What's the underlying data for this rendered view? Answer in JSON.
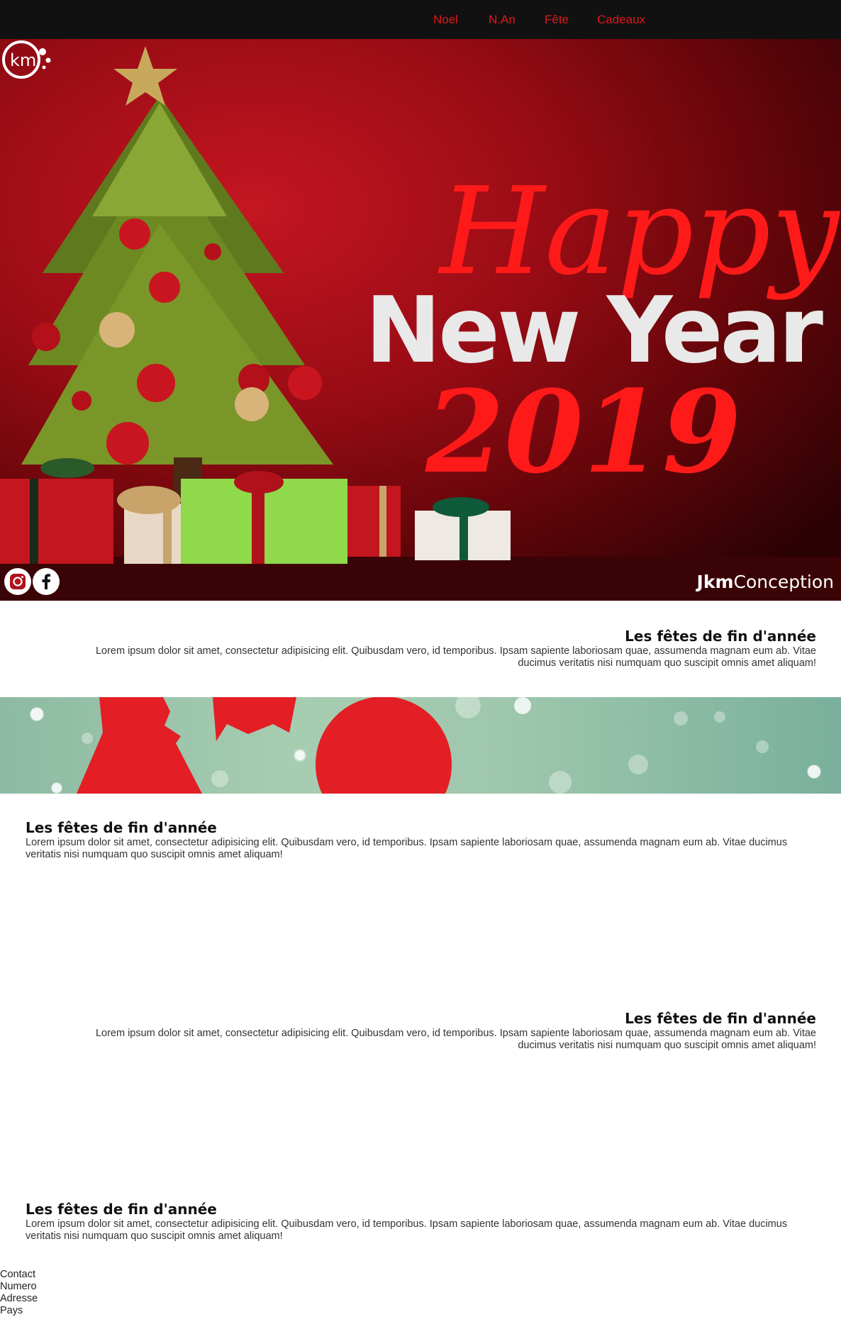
{
  "nav": {
    "items": [
      {
        "label": "Noel"
      },
      {
        "label": "N.An"
      },
      {
        "label": "Fête"
      },
      {
        "label": "Cadeaux"
      }
    ]
  },
  "hero": {
    "script_text": "Happy",
    "headline": "New Year",
    "year": "2019",
    "brand_bold": "Jkm",
    "brand_light": "Conception",
    "logo_text": "km"
  },
  "sections": [
    {
      "title": "Les fêtes de fin d'année",
      "body": "Lorem ipsum dolor sit amet, consectetur adipisicing elit. Quibusdam vero, id temporibus. Ipsam sapiente laboriosam quae, assumenda magnam eum ab. Vitae ducimus veritatis nisi numquam quo suscipit omnis amet aliquam!"
    },
    {
      "title": "Les fêtes de fin d'année",
      "body": "Lorem ipsum dolor sit amet, consectetur adipisicing elit. Quibusdam vero, id temporibus. Ipsam sapiente laboriosam quae, assumenda magnam eum ab. Vitae ducimus veritatis nisi numquam quo suscipit omnis amet aliquam!"
    },
    {
      "title": "Les fêtes de fin d'année",
      "body": "Lorem ipsum dolor sit amet, consectetur adipisicing elit. Quibusdam vero, id temporibus. Ipsam sapiente laboriosam quae, assumenda magnam eum ab. Vitae ducimus veritatis nisi numquam quo suscipit omnis amet aliquam!"
    },
    {
      "title": "Les fêtes de fin d'année",
      "body": "Lorem ipsum dolor sit amet, consectetur adipisicing elit. Quibusdam vero, id temporibus. Ipsam sapiente laboriosam quae, assumenda magnam eum ab. Vitae ducimus veritatis nisi numquam quo suscipit omnis amet aliquam!"
    }
  ],
  "footer": {
    "items": [
      "Contact",
      "Numero",
      "Adresse",
      "Pays"
    ]
  },
  "icons": {
    "instagram": "instagram-icon",
    "facebook": "facebook-icon"
  },
  "colors": {
    "nav_bg": "#111111",
    "nav_link": "#e01a1a",
    "hero_red": "#c41621",
    "script_red": "#ff1a1a",
    "banner_green": "#9fc7ad"
  }
}
